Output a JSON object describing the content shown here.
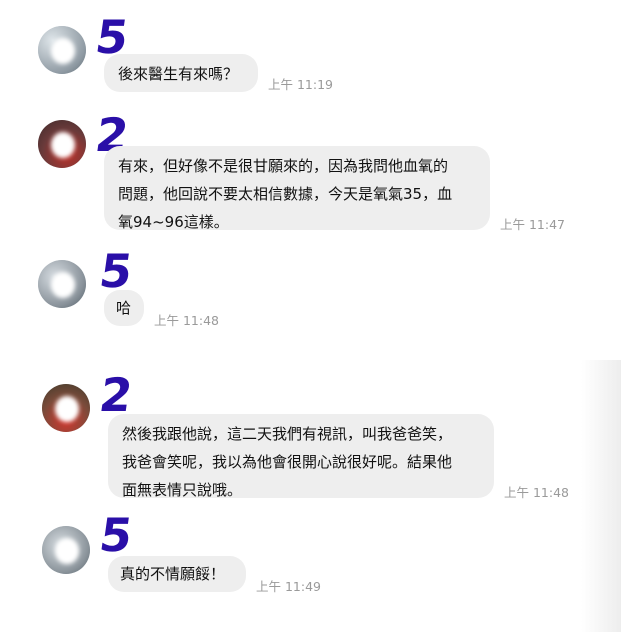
{
  "messages": [
    {
      "badge": "5",
      "lines": [
        "後來醫生有來嗎？"
      ],
      "time": "上午 11:19",
      "avatar_color": "#b9c2c9"
    },
    {
      "badge": "2",
      "lines": [
        "有來，但好像不是很甘願來的，因為我問他血氧的",
        "問題，他回說不要太相信數據，今天是氧氣35，血",
        "氧94~96這樣。"
      ],
      "time": "上午 11:47",
      "avatar_color": "#9a4a46"
    },
    {
      "badge": "5",
      "lines": [
        "哈"
      ],
      "time": "上午 11:48",
      "avatar_color": "#a9b0b8"
    },
    {
      "badge": "2",
      "lines": [
        "然後我跟他說，這二天我們有視訊，叫我爸爸笑，",
        "我爸會笑呢，我以為他會很開心說很好呢。結果他",
        "面無表情只說哦。"
      ],
      "time": "上午 11:48",
      "avatar_color": "#a44a3c"
    },
    {
      "badge": "5",
      "lines": [
        "真的不情願餒！"
      ],
      "time": "上午 11:49",
      "avatar_color": "#aeb4ba"
    }
  ],
  "colors": {
    "bubble": "#eeeeee",
    "badge_ink": "#2a0fa8",
    "timestamp": "#9a9a9a"
  }
}
